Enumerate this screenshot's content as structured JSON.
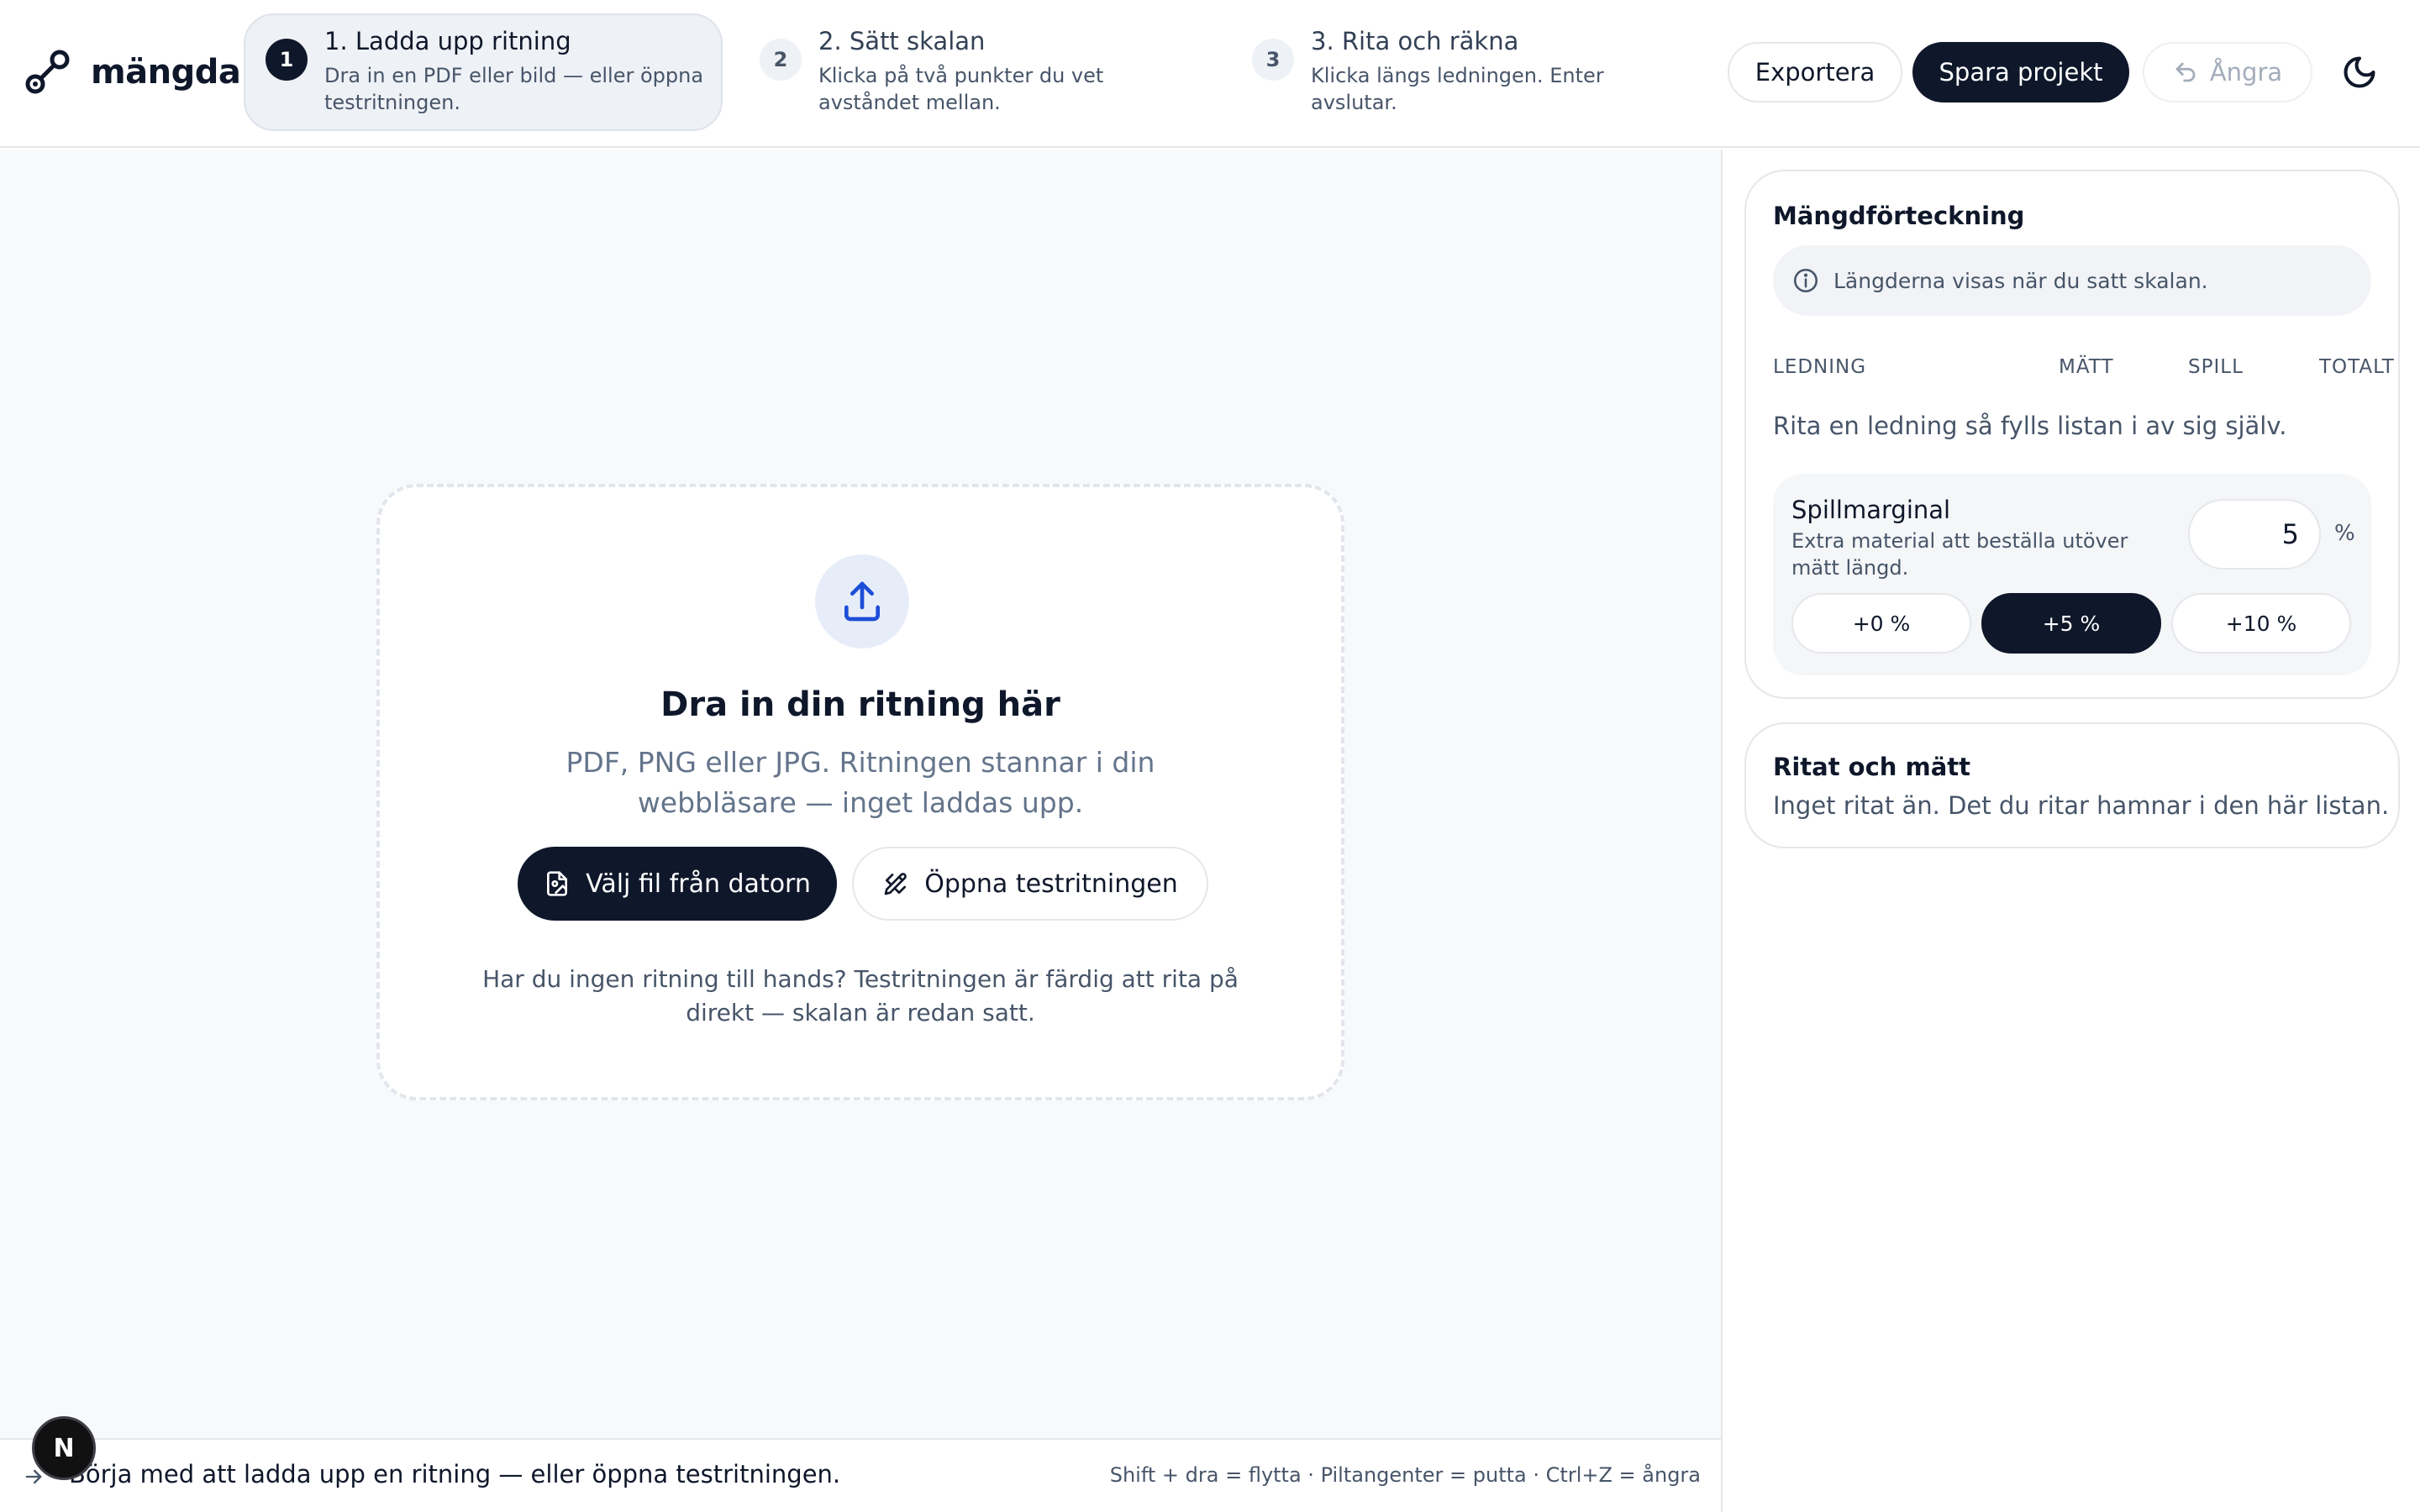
{
  "app": {
    "name": "mängda"
  },
  "steps": [
    {
      "number": "1",
      "title": "1. Ladda upp ritning",
      "description": "Dra in en PDF eller bild — eller öppna testritningen.",
      "active": true
    },
    {
      "number": "2",
      "title": "2. Sätt skalan",
      "description": "Klicka på två punkter du vet avståndet mellan.",
      "active": false
    },
    {
      "number": "3",
      "title": "3. Rita och räkna",
      "description": "Klicka längs ledningen. Enter avslutar.",
      "active": false
    }
  ],
  "toolbar": {
    "export_label": "Exportera",
    "save_label": "Spara projekt",
    "undo_label": "Ångra",
    "undo_icon": "undo-icon",
    "theme_icon": "moon-icon"
  },
  "dropzone": {
    "icon": "upload-icon",
    "title": "Dra in din ritning här",
    "subtitle": "PDF, PNG eller JPG. Ritningen stannar i din webbläsare — inget laddas upp.",
    "choose_label": "Välj fil från datorn",
    "test_label": "Öppna testritningen",
    "hint": "Har du ingen ritning till hands? Testritningen är färdig att rita på direkt — skalan är redan satt."
  },
  "statusbar": {
    "message": "Börja med att ladda upp en ritning — eller öppna testritningen.",
    "shortcuts": "Shift + dra = flytta · Piltangenter = putta · Ctrl+Z = ångra",
    "badge": "N"
  },
  "quantity_list": {
    "title": "Mängdförteckning",
    "info": "Längderna visas när du satt skalan.",
    "columns": [
      "LEDNING",
      "MÄTT",
      "SPILL",
      "TOTALT"
    ],
    "empty": "Rita en ledning så fylls listan i av sig själv."
  },
  "waste": {
    "title": "Spillmarginal",
    "description": "Extra material att beställa utöver mätt längd.",
    "value": "5",
    "unit": "%",
    "presets": [
      "+0 %",
      "+5 %",
      "+10 %"
    ],
    "active_preset": "+5 %"
  },
  "drawn": {
    "title": "Ritat och mätt",
    "empty": "Inget ritat än. Det du ritar hamnar i den här listan."
  },
  "colors": {
    "primary": "#0f172a",
    "muted": "#475569",
    "border": "#e5e7eb",
    "canvas_bg": "#f8f9fb",
    "accent_blue": "#1d4ed8"
  }
}
